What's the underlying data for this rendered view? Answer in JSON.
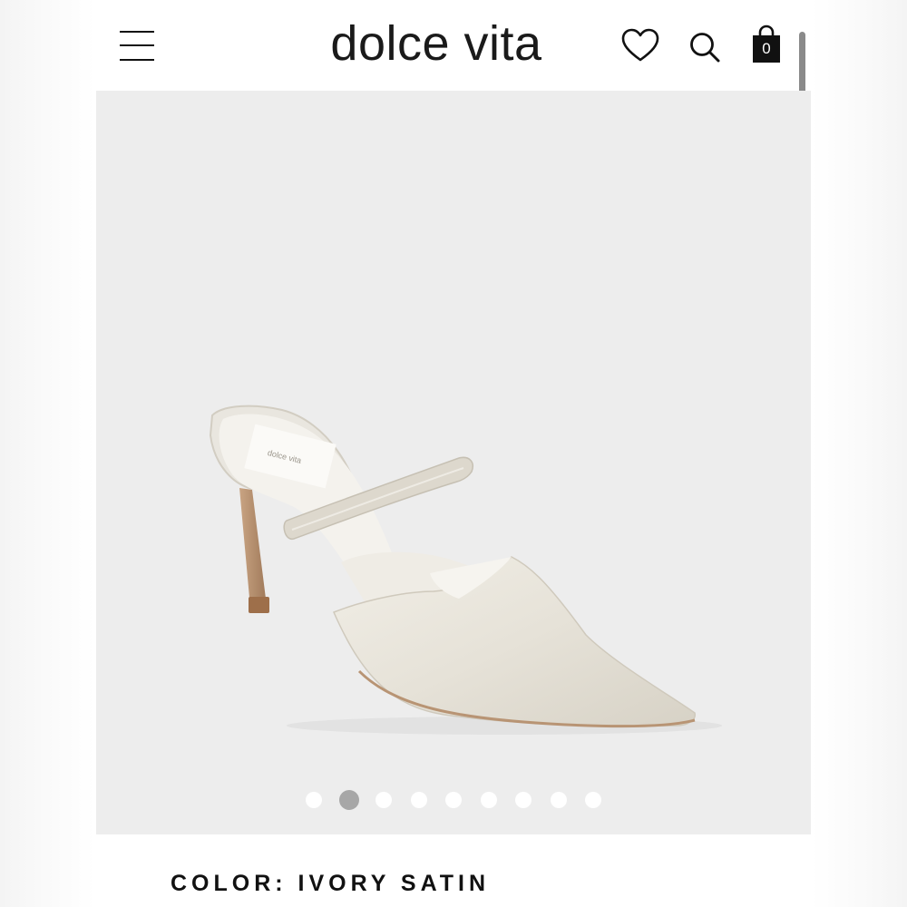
{
  "header": {
    "logo": "dolce vita",
    "cart_count": "0",
    "icons": [
      "hamburger-menu-icon",
      "heart-icon",
      "search-icon",
      "shopping-bag-icon"
    ]
  },
  "product": {
    "carousel": {
      "total_slides": 9,
      "active_index": 1
    },
    "color_label": "COLOR: IVORY SATIN"
  },
  "colors": {
    "background": "#ffffff",
    "image_background": "#ededed",
    "text": "#111111",
    "dot_active": "#a7a7a7",
    "dot_inactive": "#ffffff",
    "scrollbar": "#8a8a8a"
  }
}
